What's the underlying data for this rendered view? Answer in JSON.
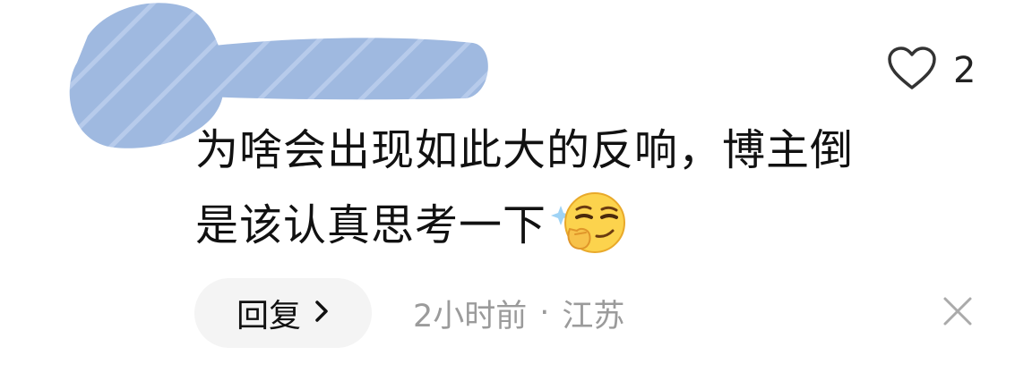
{
  "comment": {
    "text_line_1": "为啥会出现如此大的反响，博主倒",
    "text_line_2": "是该认真思考一下",
    "emoji_icon": "smirk-thinking-emoji",
    "like_count": "2",
    "like_icon": "heart-outline-icon"
  },
  "footer": {
    "reply_label": "回复",
    "reply_chevron": "›",
    "time": "2小时前",
    "separator": "·",
    "location": "江苏",
    "close_icon": "close-icon"
  },
  "colors": {
    "redaction": "#9fb9e0",
    "text": "#111111",
    "muted": "#9b9b9b",
    "pill": "#f4f4f4"
  }
}
